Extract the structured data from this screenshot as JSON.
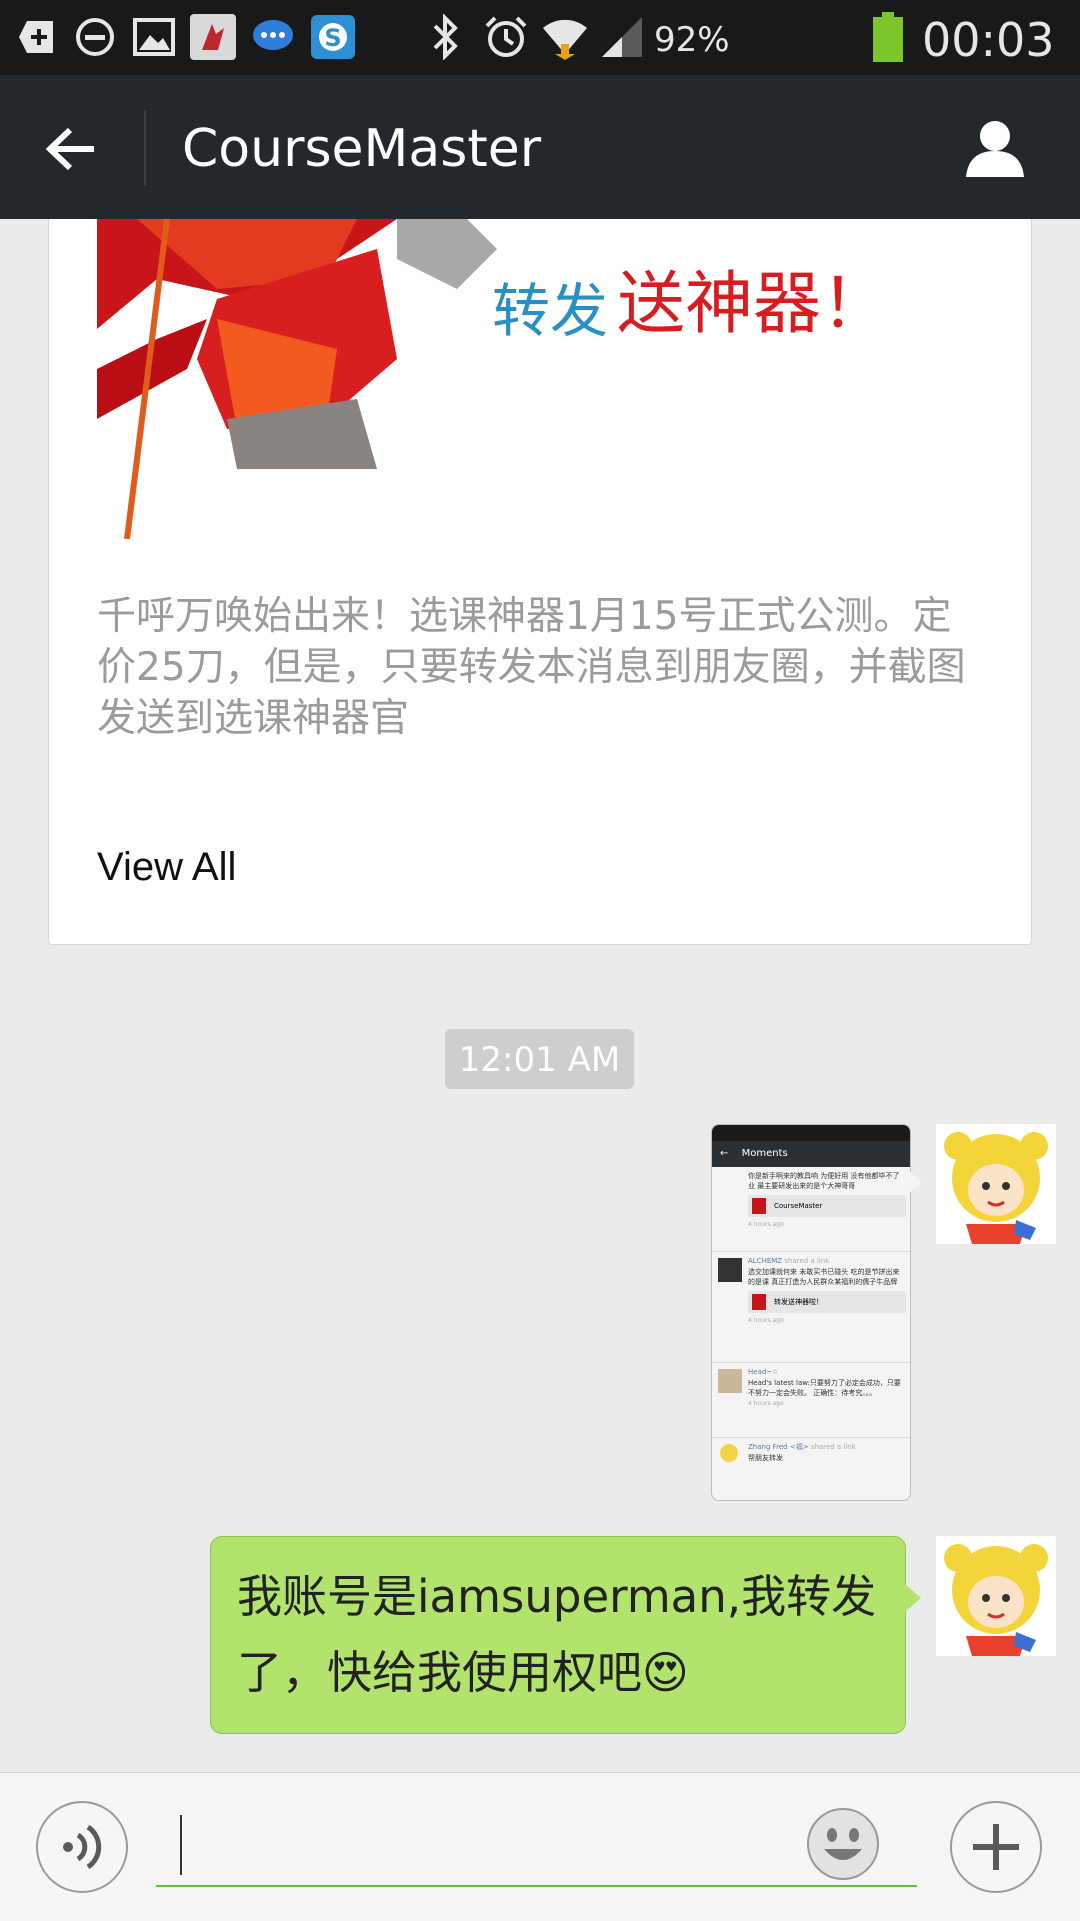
{
  "status_bar": {
    "battery_percent": "92%",
    "time": "00:03",
    "icons": [
      "add-icon",
      "minus-circle-icon",
      "image-icon",
      "app-icon",
      "message-icon",
      "skype-icon",
      "bluetooth-icon",
      "alarm-icon",
      "wifi-icon",
      "signal-icon",
      "battery-icon"
    ],
    "battery_color": "#7cc52a"
  },
  "app_bar": {
    "title": "CourseMaster",
    "back_icon": "arrow-left-icon",
    "profile_icon": "person-icon",
    "background": "#22282c"
  },
  "article_card": {
    "banner_text_blue": "转发",
    "banner_text_red": "送神器！",
    "description": "千呼万唤始出来！选课神器1月15号正式公测。定价25刀，但是，只要转发本消息到朋友圈，并截图发送到选课神器官",
    "view_all_label": "View All"
  },
  "chat": {
    "timestamp": "12:01 AM",
    "messages": [
      {
        "type": "image",
        "sender": "self",
        "screenshot": {
          "header_title": "Moments",
          "entries": [
            {
              "name": "",
              "text": "你是新手啊来的教具响 为便好用 没有他都毕不了业 最主要研发出来的是个大神哥哥",
              "link_title": "CourseMaster",
              "time": "4 hours ago"
            },
            {
              "name": "ALCHEMZ",
              "action": "shared a link",
              "text": "选交加课就何来 未敢买书已碰头 吃的是节拼出来的是课 真正打造为人民群众某福利的儒子牛品牌",
              "link_title": "转发送神器啦！",
              "time": "4 hours ago"
            },
            {
              "name": "Head~☆",
              "text": "Head's latest law:只要努力了必定会成功，只要不努力一定会失败。 正确性：待考究。。。",
              "time": "4 hours ago"
            },
            {
              "name": "Zhang Fred <福>",
              "action": "shared a link",
              "text": "帮朋友转发"
            }
          ]
        }
      },
      {
        "type": "text",
        "sender": "self",
        "text": "我账号是iamsuperman,我转发了，快给我使用权吧",
        "emoji": "😍"
      }
    ]
  },
  "input_bar": {
    "voice_icon": "voice-icon",
    "emoji_icon": "smiley-icon",
    "plus_icon": "plus-icon",
    "input_value": "",
    "accent": "#63bf3a"
  },
  "colors": {
    "bubble_green": "#b2e36c",
    "chat_bg": "#ebebeb"
  }
}
